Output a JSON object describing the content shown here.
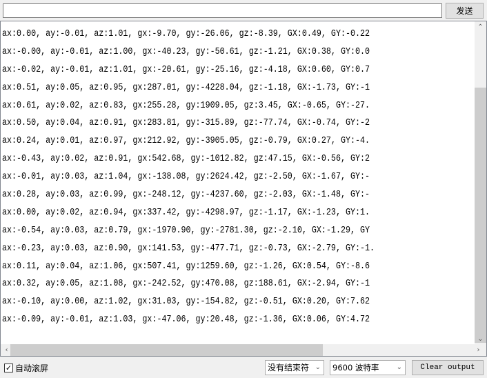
{
  "send_input": {
    "value": ""
  },
  "send_button": "发送",
  "output_lines": [
    "ax:0.00, ay:-0.01, az:1.01, gx:-9.70, gy:-26.06, gz:-8.39, GX:0.49, GY:-0.22",
    "ax:-0.00, ay:-0.01, az:1.00, gx:-40.23, gy:-50.61, gz:-1.21, GX:0.38, GY:0.0",
    "ax:-0.02, ay:-0.01, az:1.01, gx:-20.61, gy:-25.16, gz:-4.18, GX:0.60, GY:0.7",
    "ax:0.51, ay:0.05, az:0.95, gx:287.01, gy:-4228.04, gz:-1.18, GX:-1.73, GY:-1",
    "ax:0.61, ay:0.02, az:0.83, gx:255.28, gy:1909.05, gz:3.45, GX:-0.65, GY:-27.",
    "ax:0.50, ay:0.04, az:0.91, gx:283.81, gy:-315.89, gz:-77.74, GX:-0.74, GY:-2",
    "ax:0.24, ay:0.01, az:0.97, gx:212.92, gy:-3905.05, gz:-0.79, GX:0.27, GY:-4.",
    "ax:-0.43, ay:0.02, az:0.91, gx:542.68, gy:-1012.82, gz:47.15, GX:-0.56, GY:2",
    "ax:-0.01, ay:0.03, az:1.04, gx:-138.08, gy:2624.42, gz:-2.50, GX:-1.67, GY:-",
    "ax:0.28, ay:0.03, az:0.99, gx:-248.12, gy:-4237.60, gz:-2.03, GX:-1.48, GY:-",
    "ax:0.00, ay:0.02, az:0.94, gx:337.42, gy:-4298.97, gz:-1.17, GX:-1.23, GY:1.",
    "ax:-0.54, ay:0.03, az:0.79, gx:-1970.90, gy:-2781.30, gz:-2.10, GX:-1.29, GY",
    "ax:-0.23, ay:0.03, az:0.90, gx:141.53, gy:-477.71, gz:-0.73, GX:-2.79, GY:-1.",
    "ax:0.11, ay:0.04, az:1.06, gx:507.41, gy:1259.60, gz:-1.26, GX:0.54, GY:-8.6",
    "ax:0.32, ay:0.05, az:1.08, gx:-242.52, gy:470.08, gz:188.61, GX:-2.94, GY:-1",
    "ax:-0.10, ay:0.00, az:1.02, gx:31.03, gy:-154.82, gz:-0.51, GX:0.20, GY:7.62",
    "ax:-0.09, ay:-0.01, az:1.03, gx:-47.06, gy:20.48, gz:-1.36, GX:0.06, GY:4.72"
  ],
  "autoscroll": {
    "label": "自动滚屏",
    "checked": true
  },
  "line_ending": "没有结束符",
  "baud_rate": "9600 波特率",
  "clear_button": "Clear output"
}
